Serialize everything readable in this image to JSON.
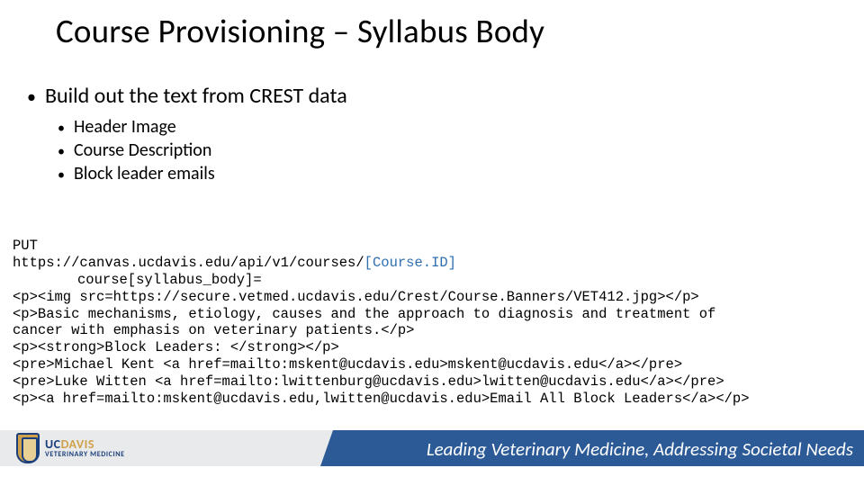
{
  "title": "Course Provisioning – Syllabus Body",
  "bullets": {
    "main": "Build out the text from CREST data",
    "subs": [
      "Header Image",
      "Course Description",
      "Block leader emails"
    ]
  },
  "code": {
    "method": "PUT",
    "url_prefix": "https://canvas.ucdavis.edu/api/v1/courses/",
    "url_param": "[Course.ID]",
    "body_key": "course[syllabus_body]=",
    "lines": [
      "<p><img src=https://secure.vetmed.ucdavis.edu/Crest/Course.Banners/VET412.jpg></p>",
      "<p>Basic mechanisms, etiology, causes and the approach to diagnosis and treatment of",
      "cancer with emphasis on veterinary patients.</p>",
      "<p><strong>Block Leaders: </strong></p>",
      "<pre>Michael Kent <a href=mailto:mskent@ucdavis.edu>mskent@ucdavis.edu</a></pre>",
      "<pre>Luke Witten <a href=mailto:lwittenburg@ucdavis.edu>lwitten@ucdavis.edu</a></pre>",
      "<p><a href=mailto:mskent@ucdavis.edu,lwitten@ucdavis.edu>Email All Block Leaders</a></p>"
    ]
  },
  "footer": {
    "logo_top_uc": "UC",
    "logo_top_davis": "DAVIS",
    "logo_bottom": "VETERINARY MEDICINE",
    "tagline": "Leading Veterinary Medicine, Addressing Societal Needs"
  }
}
